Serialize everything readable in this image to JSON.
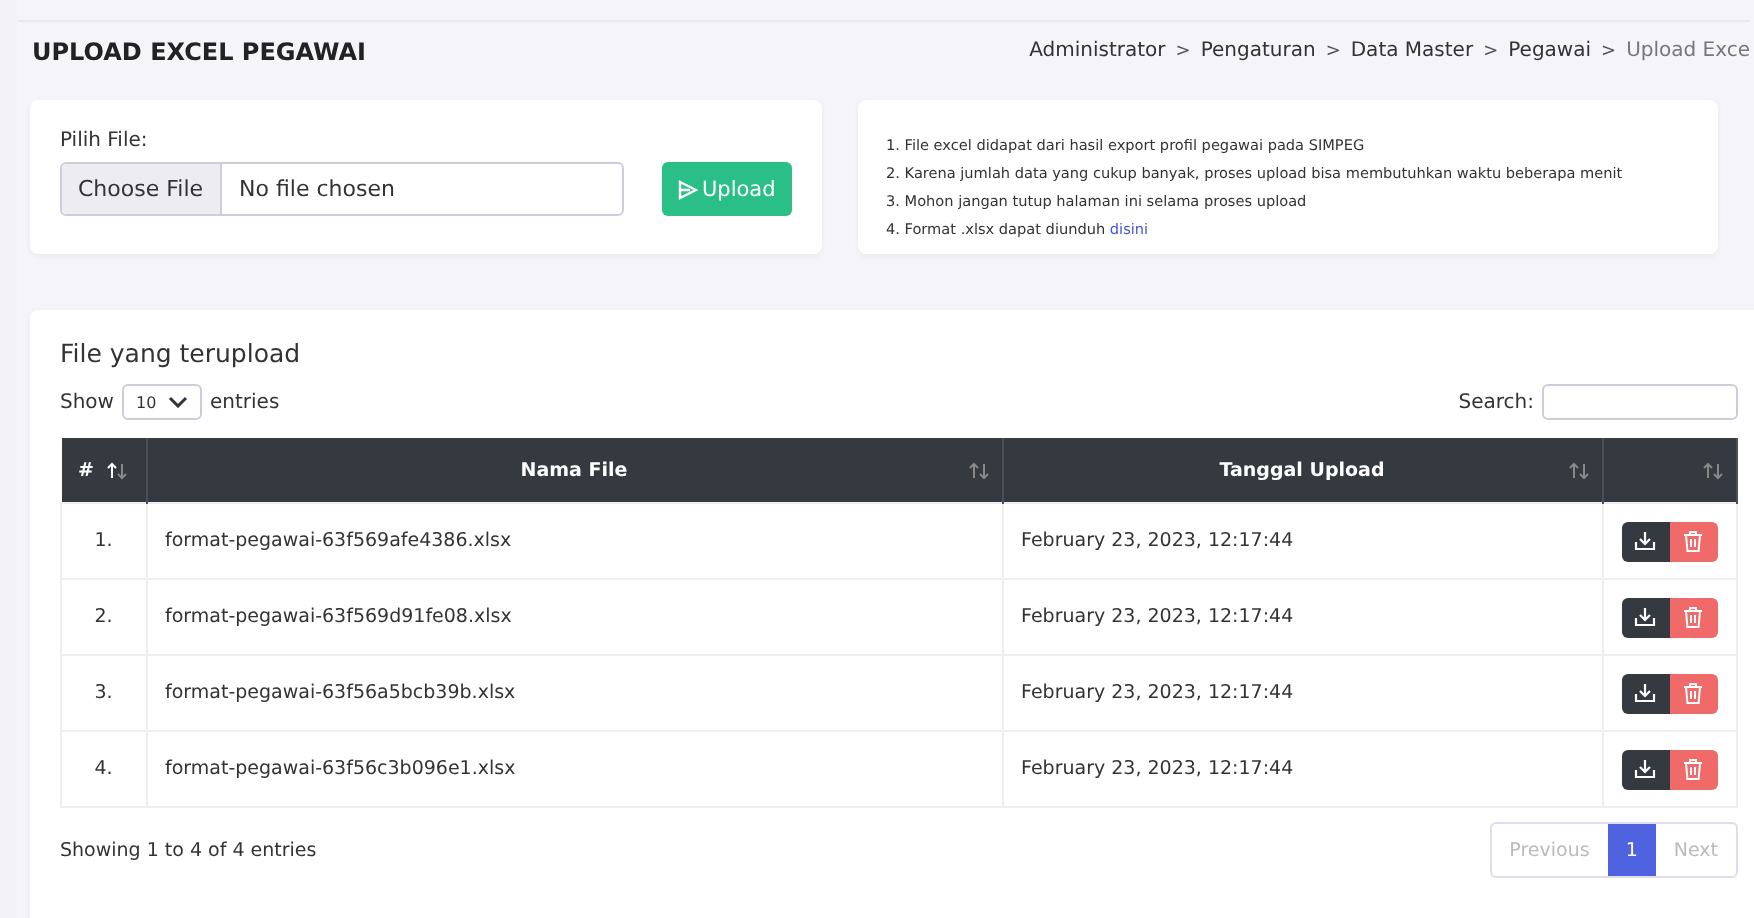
{
  "page_title": "UPLOAD EXCEL PEGAWAI",
  "breadcrumb": {
    "separator": ">",
    "items": [
      "Administrator",
      "Pengaturan",
      "Data Master",
      "Pegawai",
      "Upload Exce"
    ]
  },
  "upload_form": {
    "label": "Pilih File:",
    "choose_button": "Choose File",
    "file_status": "No file chosen",
    "upload_button": "Upload"
  },
  "notes": [
    {
      "text": "1. File excel didapat dari hasil export profil pegawai pada SIMPEG"
    },
    {
      "text": "2. Karena jumlah data yang cukup banyak, proses upload bisa membutuhkan waktu beberapa menit"
    },
    {
      "text": "3. Mohon jangan tutup halaman ini selama proses upload"
    },
    {
      "text": "4. Format .xlsx dapat diunduh ",
      "link": "disini"
    }
  ],
  "table_card": {
    "title": "File yang terupload",
    "show_label": "Show",
    "page_size": "10",
    "entries_label": "entries",
    "search_label": "Search:"
  },
  "table": {
    "columns": [
      "#",
      "Nama File",
      "Tanggal Upload"
    ],
    "rows": [
      {
        "no": "1.",
        "file": "format-pegawai-63f569afe4386.xlsx",
        "date": "February 23, 2023, 12:17:44"
      },
      {
        "no": "2.",
        "file": "format-pegawai-63f569d91fe08.xlsx",
        "date": "February 23, 2023, 12:17:44"
      },
      {
        "no": "3.",
        "file": "format-pegawai-63f56a5bcb39b.xlsx",
        "date": "February 23, 2023, 12:17:44"
      },
      {
        "no": "4.",
        "file": "format-pegawai-63f56c3b096e1.xlsx",
        "date": "February 23, 2023, 12:17:44"
      }
    ]
  },
  "summary": "Showing 1 to 4 of 4 entries",
  "pagination": [
    {
      "label": "Previous",
      "disabled": true,
      "selected": false
    },
    {
      "label": "1",
      "disabled": false,
      "selected": true
    },
    {
      "label": "Next",
      "disabled": true,
      "selected": false
    }
  ]
}
